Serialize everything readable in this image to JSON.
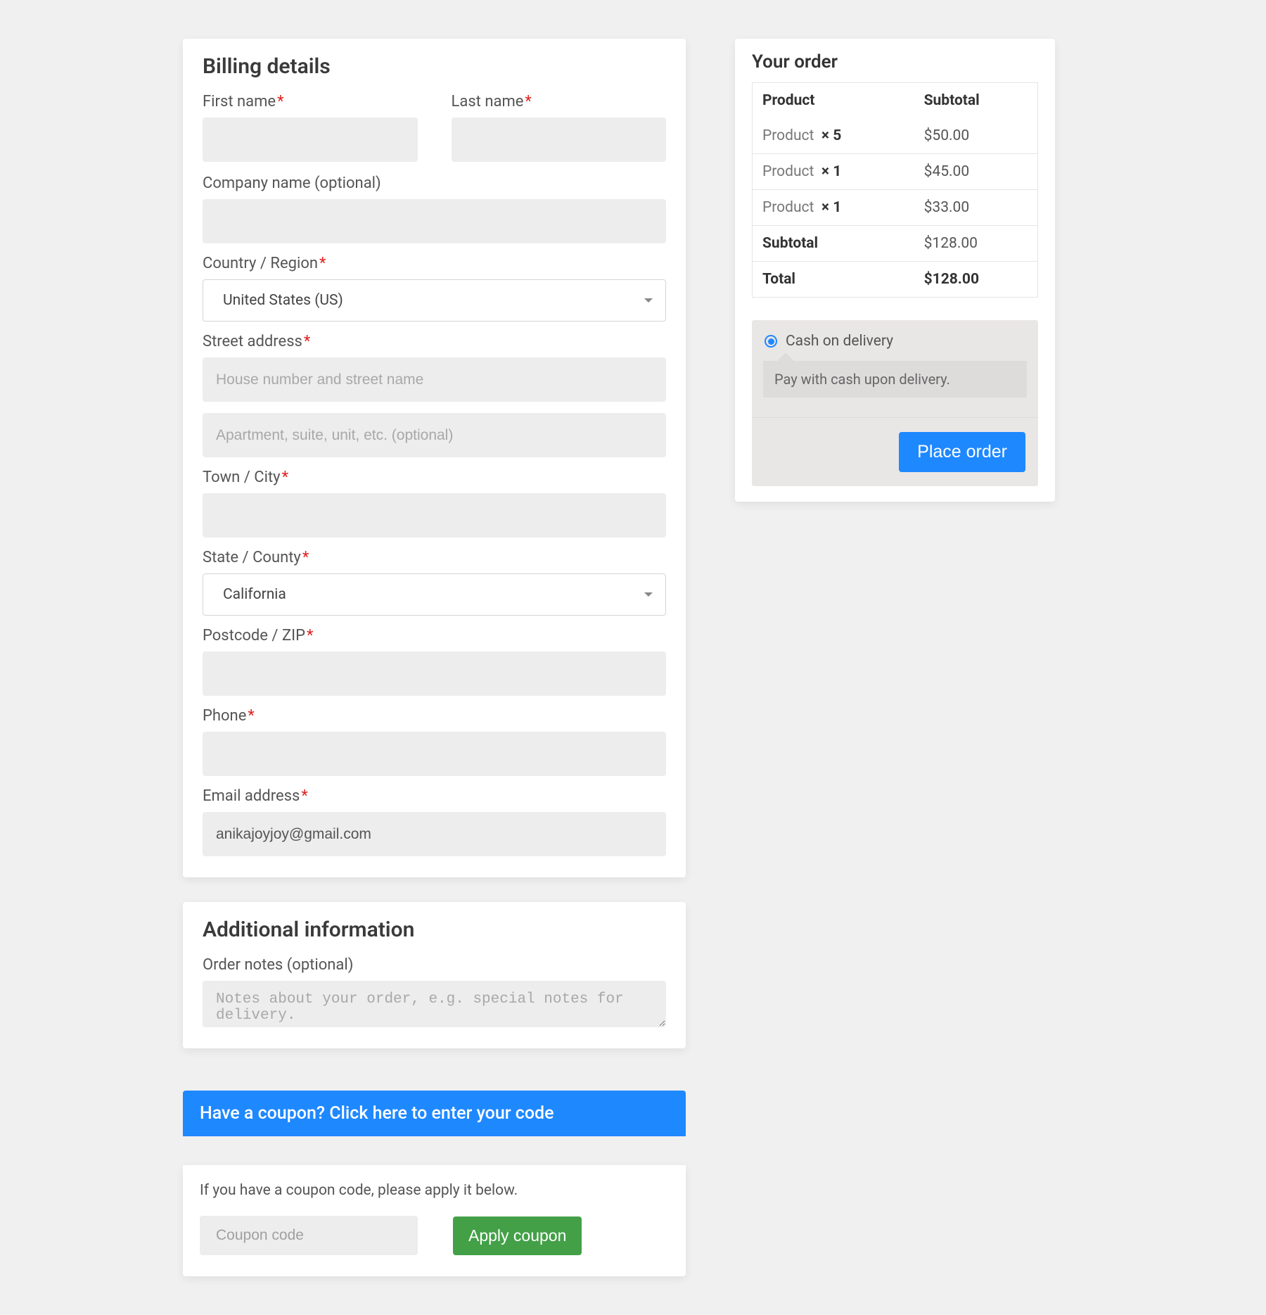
{
  "billing": {
    "title": "Billing details",
    "first_name_label": "First name",
    "last_name_label": "Last name",
    "company_label": "Company name (optional)",
    "country_label": "Country / Region",
    "country_value": "United States (US)",
    "street_label": "Street address",
    "street_ph1": "House number and street name",
    "street_ph2": "Apartment, suite, unit, etc. (optional)",
    "city_label": "Town / City",
    "state_label": "State / County",
    "state_value": "California",
    "postcode_label": "Postcode / ZIP",
    "phone_label": "Phone",
    "email_label": "Email address",
    "email_value": "anikajoyjoy@gmail.com"
  },
  "additional": {
    "title": "Additional information",
    "label": "Order notes (optional)",
    "placeholder": "Notes about your order, e.g. special notes for delivery."
  },
  "coupon": {
    "bar_text": "Have a coupon? Click here to enter your code",
    "instr": "If you have a coupon code, please apply it below.",
    "placeholder": "Coupon code",
    "button": "Apply coupon"
  },
  "order": {
    "title": "Your order",
    "col_product": "Product",
    "col_subtotal": "Subtotal",
    "items": [
      {
        "name": "Product",
        "qty": "× 5",
        "subtotal": "$50.00"
      },
      {
        "name": "Product",
        "qty": "× 1",
        "subtotal": "$45.00"
      },
      {
        "name": "Product",
        "qty": "× 1",
        "subtotal": "$33.00"
      }
    ],
    "subtotal_label": "Subtotal",
    "subtotal_value": "$128.00",
    "total_label": "Total",
    "total_value": "$128.00"
  },
  "payment": {
    "option_label": "Cash on delivery",
    "option_desc": "Pay with cash upon delivery.",
    "place_order": "Place order"
  }
}
